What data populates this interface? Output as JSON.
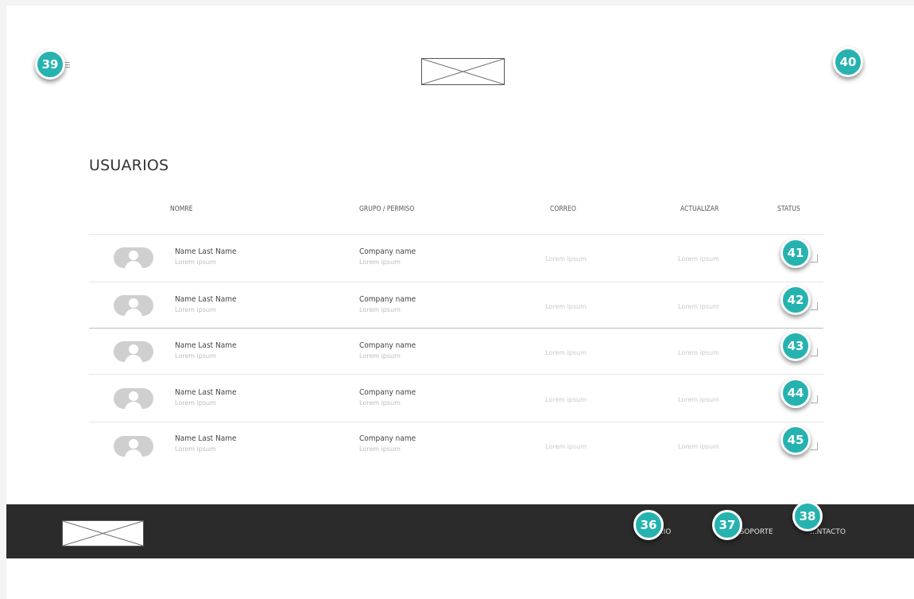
{
  "page": {
    "title": "USUARIOS"
  },
  "header": {
    "logo_icon": "image-placeholder-icon",
    "menu_icon": "hamburger-menu-icon"
  },
  "annotations": {
    "menu": "39",
    "user": "40",
    "rows": [
      "41",
      "42",
      "43",
      "44",
      "45"
    ],
    "footer": [
      "36",
      "37",
      "38"
    ]
  },
  "table": {
    "headers": [
      "NOMRE",
      "GRUPO / PERMISO",
      "CORREO",
      "ACTUALIZAR",
      "STATUS"
    ],
    "rows": [
      {
        "name": "Name Last Name",
        "name_sub": "Lorem ipsum",
        "company": "Company name",
        "company_sub": "Lorem ipsum",
        "correo": "Lorem ipsum",
        "actualizar": "Lorem ipsum"
      },
      {
        "name": "Name Last Name",
        "name_sub": "Lorem ipsum",
        "company": "Company name",
        "company_sub": "Lorem ipsum",
        "correo": "Lorem ipsum",
        "actualizar": "Lorem ipsum"
      },
      {
        "name": "Name Last Name",
        "name_sub": "Lorem ipsum",
        "company": "Company name",
        "company_sub": "Lorem ipsum",
        "correo": "Lorem ipsum",
        "actualizar": "Lorem ipsum"
      },
      {
        "name": "Name Last Name",
        "name_sub": "Lorem ipsum",
        "company": "Company name",
        "company_sub": "Lorem ipsum",
        "correo": "Lorem ipsum",
        "actualizar": "Lorem ipsum"
      },
      {
        "name": "Name Last Name",
        "name_sub": "Lorem ipsum",
        "company": "Company name",
        "company_sub": "Lorem ipsum",
        "correo": "Lorem ipsum",
        "actualizar": "Lorem ipsum"
      }
    ]
  },
  "footer": {
    "links": [
      "...IO",
      "...SOPORTE",
      "...NTACTO"
    ]
  },
  "colors": {
    "badge": "#26b3b0",
    "footer_bg": "#2b2b2b"
  }
}
